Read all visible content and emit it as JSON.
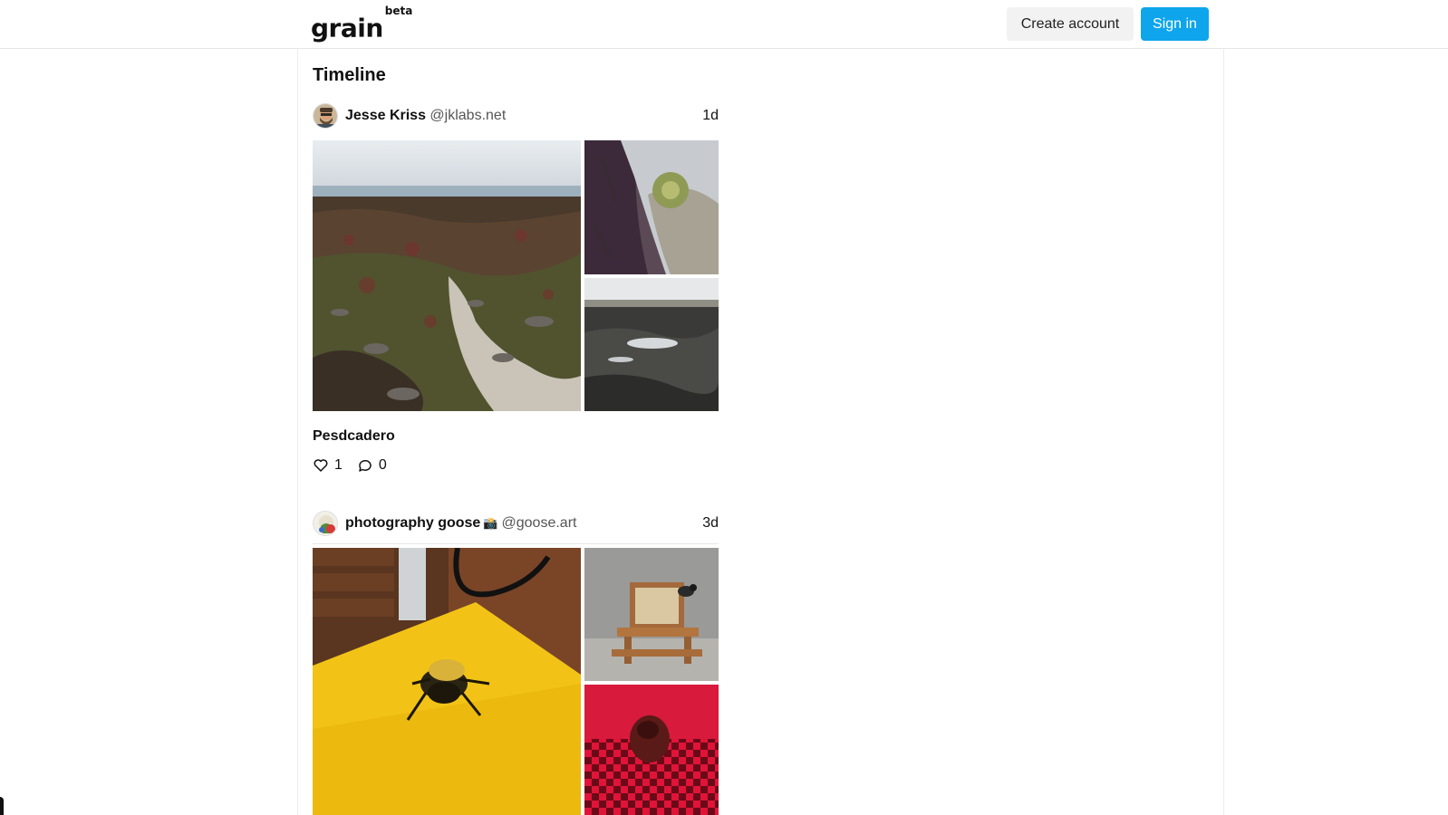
{
  "app": {
    "logo": "grain",
    "logo_badge": "beta"
  },
  "header": {
    "create_account_label": "Create account",
    "sign_in_label": "Sign in",
    "accent_color": "#0ea5ec"
  },
  "timeline": {
    "title": "Timeline",
    "posts": [
      {
        "author_name": "Jesse Kriss",
        "author_handle": "@jklabs.net",
        "time": "1d",
        "title": "Pesdcadero",
        "likes": "1",
        "comments": "0",
        "photos": [
          "tidepool-seaweed-rocks",
          "sea-anemone",
          "rocky-shore-pools"
        ]
      },
      {
        "author_name": "photography goose",
        "author_emoji": "📸",
        "author_handle": "@goose.art",
        "time": "3d",
        "photos": [
          "bee-on-yellow-surface",
          "bird-at-picnic-table-feeder",
          "red-checkered-cloth"
        ]
      }
    ]
  }
}
